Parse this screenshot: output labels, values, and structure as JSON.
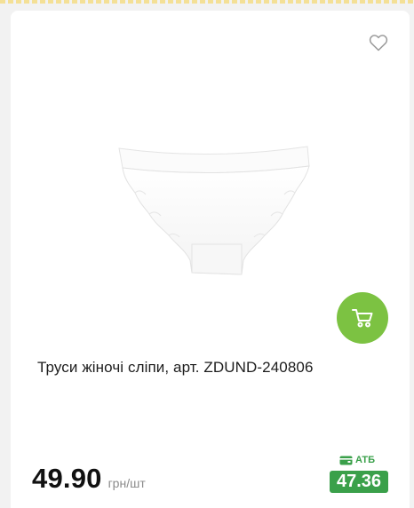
{
  "product": {
    "title": "Труси жіночі сліпи, арт. ZDUND-240806",
    "price": "49.90",
    "unit": "грн/шт",
    "club_label": "АТБ",
    "club_price": "47.36"
  },
  "icons": {
    "favorite": "heart-outline-icon",
    "cart": "cart-icon",
    "club": "wallet-icon"
  },
  "colors": {
    "cart_button": "#7cc242",
    "club_badge": "#3aa04a",
    "price_text": "#111111"
  }
}
